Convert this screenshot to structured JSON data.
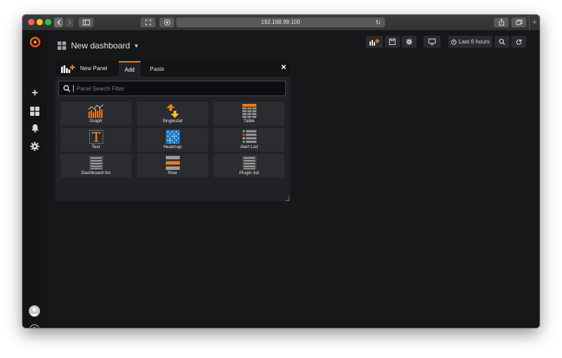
{
  "browser": {
    "url": "192.168.99.100"
  },
  "dashboard": {
    "title": "New dashboard",
    "time_range": "Last 6 hours"
  },
  "panel": {
    "title": "New Panel",
    "tabs": [
      {
        "label": "Add",
        "active": true
      },
      {
        "label": "Paste",
        "active": false
      }
    ],
    "search_placeholder": "Panel Search Filter",
    "items": [
      {
        "label": "Graph",
        "icon": "graph-icon"
      },
      {
        "label": "Singlestat",
        "icon": "singlestat-icon"
      },
      {
        "label": "Table",
        "icon": "table-icon"
      },
      {
        "label": "Text",
        "icon": "text-icon"
      },
      {
        "label": "Heatmap",
        "icon": "heatmap-icon"
      },
      {
        "label": "Alert List",
        "icon": "alert-list-icon"
      },
      {
        "label": "Dashboard list",
        "icon": "dashboard-list-icon"
      },
      {
        "label": "Row",
        "icon": "row-icon"
      },
      {
        "label": "Plugin list",
        "icon": "plugin-list-icon"
      }
    ]
  },
  "colors": {
    "accent": "#eb7b18",
    "background": "#161719",
    "panel": "#202226"
  }
}
